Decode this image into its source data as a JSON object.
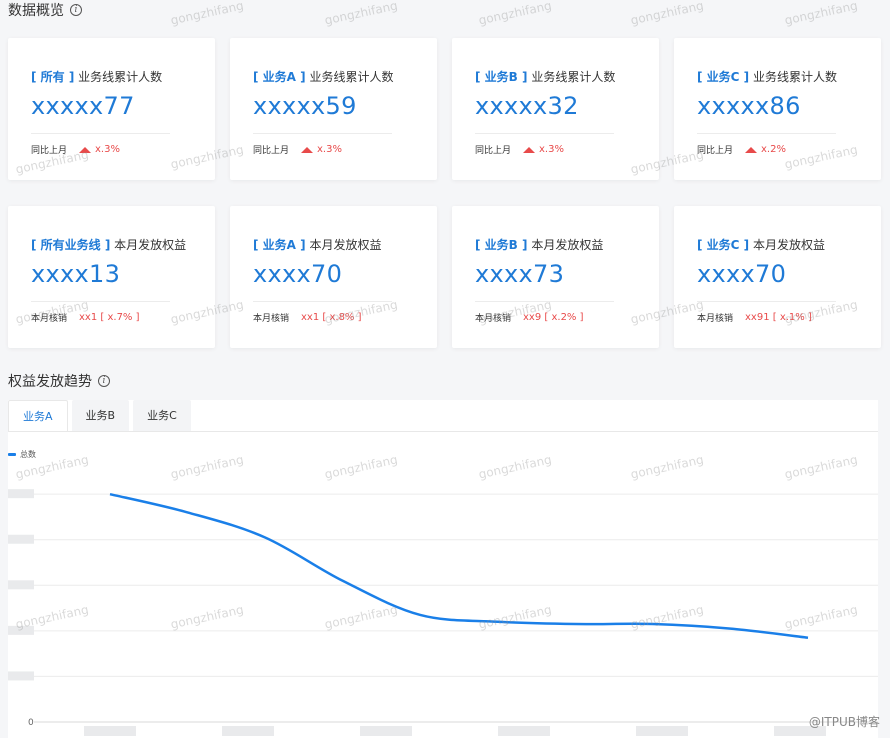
{
  "overview": {
    "title": "数据概览"
  },
  "cards_row1": [
    {
      "bracket": "[ 所有 ]",
      "label": "业务线累计人数",
      "value": "xxxxx77",
      "foot_label": "同比上月",
      "change": "x.3%"
    },
    {
      "bracket": "[ 业务A ]",
      "label": "业务线累计人数",
      "value": "xxxxx59",
      "foot_label": "同比上月",
      "change": "x.3%"
    },
    {
      "bracket": "[ 业务B ]",
      "label": "业务线累计人数",
      "value": "xxxxx32",
      "foot_label": "同比上月",
      "change": "x.3%"
    },
    {
      "bracket": "[ 业务C ]",
      "label": "业务线累计人数",
      "value": "xxxxx86",
      "foot_label": "同比上月",
      "change": "x.2%"
    }
  ],
  "cards_row2": [
    {
      "bracket": "[ 所有业务线 ]",
      "label": "本月发放权益",
      "value": "xxxx13",
      "foot_label": "本月核销",
      "detail": "xx1 [ x.7% ]"
    },
    {
      "bracket": "[ 业务A ]",
      "label": "本月发放权益",
      "value": "xxxx70",
      "foot_label": "本月核销",
      "detail": "xx1 [ x.8% ]"
    },
    {
      "bracket": "[ 业务B ]",
      "label": "本月发放权益",
      "value": "xxxx73",
      "foot_label": "本月核销",
      "detail": "xx9 [ x.2% ]"
    },
    {
      "bracket": "[ 业务C ]",
      "label": "本月发放权益",
      "value": "xxxx70",
      "foot_label": "本月核销",
      "detail": "xx91 [ x.1% ]"
    }
  ],
  "trend": {
    "title": "权益发放趋势",
    "tabs": [
      "业务A",
      "业务B",
      "业务C"
    ],
    "active_tab": 0
  },
  "chart_data": {
    "type": "line",
    "series": [
      {
        "name": "总数",
        "values": [
          100,
          92,
          81,
          62,
          47,
          44,
          43,
          43,
          41,
          37
        ]
      }
    ],
    "x": [
      0,
      1,
      2,
      3,
      4,
      5,
      6,
      7,
      8,
      9
    ],
    "ylim": [
      0,
      115
    ],
    "y_tick_labels": [
      "0"
    ],
    "color": "#1a7fe8",
    "grid": true
  },
  "watermark": "gongzhifang",
  "source_mark": "@ITPUB博客",
  "colors": {
    "accent": "#1f7ad6",
    "up": "#e84a4a",
    "line": "#1a7fe8"
  }
}
